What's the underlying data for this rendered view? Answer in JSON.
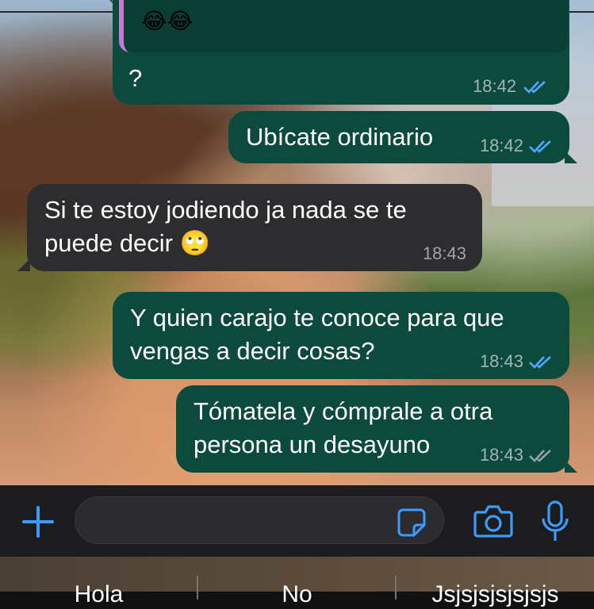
{
  "quoted_message": {
    "emojis": "😂😂"
  },
  "messages": [
    {
      "text": "?",
      "time": "18:42",
      "direction": "outgoing",
      "status": "read"
    },
    {
      "text": "Ubícate ordinario",
      "time": "18:42",
      "direction": "outgoing",
      "status": "read"
    },
    {
      "text_line1": "Si te estoy jodiendo ja nada se te",
      "text_line2": "puede decir 🙄",
      "time": "18:43",
      "direction": "incoming"
    },
    {
      "text_line1": "Y quien carajo te conoce para que",
      "text_line2": "vengas a decir cosas?",
      "time": "18:43",
      "direction": "outgoing",
      "status": "read"
    },
    {
      "text_line1": "Tómatela y cómprale a otra",
      "text_line2": "persona un desayuno",
      "time": "18:43",
      "direction": "outgoing",
      "status": "delivered"
    }
  ],
  "input": {
    "value": "",
    "placeholder": ""
  },
  "icons": {
    "attach": "plus-icon",
    "sticker": "sticker-icon",
    "camera": "camera-icon",
    "mic": "microphone-icon",
    "read_receipt": "double-check-icon"
  },
  "colors": {
    "outgoing_bubble": "#0c4a3d",
    "incoming_bubble": "#2d2d2f",
    "accent": "#3b9cff",
    "read_tick": "#53a6ff",
    "delivered_tick": "#8fa3ad"
  },
  "keyboard_suggestions": [
    "Hola",
    "No",
    "Jsjsjsjsjsjsjs"
  ]
}
